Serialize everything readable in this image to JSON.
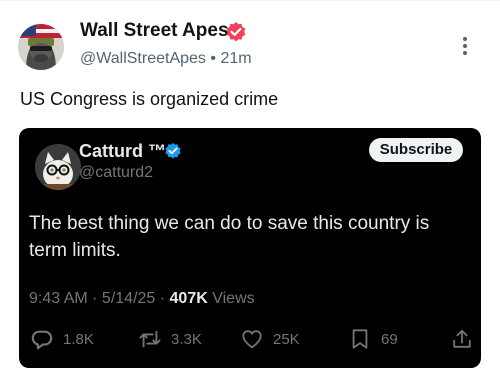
{
  "post": {
    "author_name": "Wall Street Apes",
    "author_handle": "@WallStreetApes",
    "separator": "•",
    "time_ago": "21m",
    "text": "US Congress is organized crime"
  },
  "quoted": {
    "author_name": "Catturd ™",
    "author_handle": "@catturd2",
    "subscribe_label": "Subscribe",
    "text": "The best thing we can do to save this country is term limits.",
    "timestamp": "9:43 AM · 5/14/25 · ",
    "views_count": "407K",
    "views_label": " Views",
    "actions": {
      "replies": "1.8K",
      "reposts": "3.3K",
      "likes": "25K",
      "bookmarks": "69"
    }
  },
  "colors": {
    "verified_red": "#f2405f",
    "verified_blue": "#1d9bf0",
    "card_background": "#000000",
    "muted_text": "#71767b"
  },
  "icons": [
    "verified-badge-icon",
    "more-options-icon",
    "reply-icon",
    "repost-icon",
    "like-icon",
    "bookmark-icon",
    "share-icon"
  ]
}
